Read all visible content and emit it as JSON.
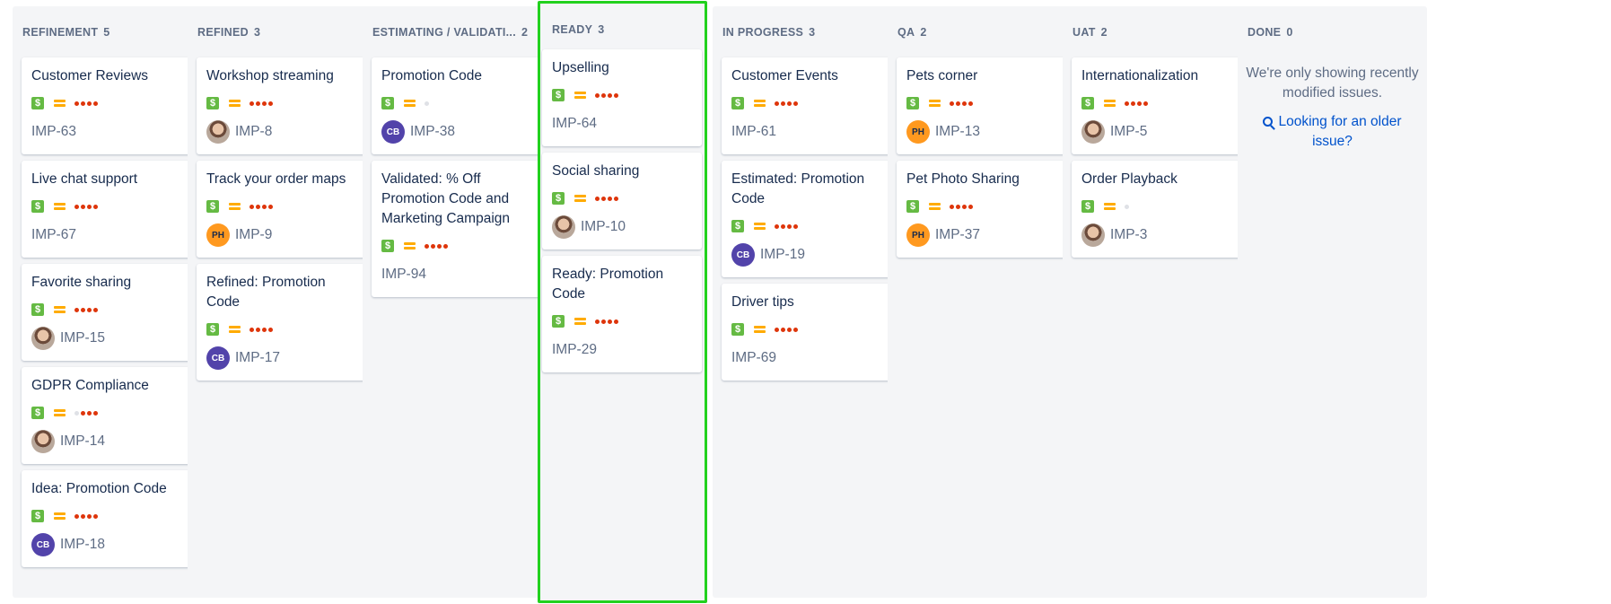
{
  "columns": [
    {
      "name": "REFINEMENT",
      "count": "5",
      "cards": [
        {
          "title": "Customer Reviews",
          "key": "IMP-63",
          "assignee": null,
          "story_points_dots": 4
        },
        {
          "title": "Live chat support",
          "key": "IMP-67",
          "assignee": null,
          "story_points_dots": 4
        },
        {
          "title": "Favorite sharing",
          "key": "IMP-15",
          "assignee": "photo",
          "story_points_dots": 4
        },
        {
          "title": "GDPR Compliance",
          "key": "IMP-14",
          "assignee": "photo",
          "story_points_dots": 3
        },
        {
          "title": "Idea: Promotion Code",
          "key": "IMP-18",
          "assignee": "CB",
          "story_points_dots": 4
        }
      ]
    },
    {
      "name": "REFINED",
      "count": "3",
      "cards": [
        {
          "title": "Workshop streaming",
          "key": "IMP-8",
          "assignee": "photo",
          "story_points_dots": 4
        },
        {
          "title": "Track your order maps",
          "key": "IMP-9",
          "assignee": "PH",
          "story_points_dots": 4
        },
        {
          "title": "Refined: Promotion Code",
          "key": "IMP-17",
          "assignee": "CB",
          "story_points_dots": 4
        }
      ]
    },
    {
      "name": "ESTIMATING / VALIDATI...",
      "count": "2",
      "cards": [
        {
          "title": "Promotion Code",
          "key": "IMP-38",
          "assignee": "CB",
          "story_points_dots": 0
        },
        {
          "title": "Validated: % Off Promotion Code and Marketing Campaign",
          "key": "IMP-94",
          "assignee": null,
          "story_points_dots": 4
        }
      ]
    },
    {
      "name": "READY",
      "count": "3",
      "highlighted": true,
      "cards": [
        {
          "title": "Upselling",
          "key": "IMP-64",
          "assignee": null,
          "story_points_dots": 4
        },
        {
          "title": "Social sharing",
          "key": "IMP-10",
          "assignee": "photo",
          "story_points_dots": 4
        },
        {
          "title": "Ready: Promotion Code",
          "key": "IMP-29",
          "assignee": null,
          "story_points_dots": 4
        }
      ]
    },
    {
      "name": "IN PROGRESS",
      "count": "3",
      "cards": [
        {
          "title": "Customer Events",
          "key": "IMP-61",
          "assignee": null,
          "story_points_dots": 4
        },
        {
          "title": "Estimated: Promotion Code",
          "key": "IMP-19",
          "assignee": "CB",
          "story_points_dots": 4
        },
        {
          "title": "Driver tips",
          "key": "IMP-69",
          "assignee": null,
          "story_points_dots": 4
        }
      ]
    },
    {
      "name": "QA",
      "count": "2",
      "cards": [
        {
          "title": "Pets corner",
          "key": "IMP-13",
          "assignee": "PH",
          "story_points_dots": 4
        },
        {
          "title": "Pet Photo Sharing",
          "key": "IMP-37",
          "assignee": "PH",
          "story_points_dots": 4
        }
      ]
    },
    {
      "name": "UAT",
      "count": "2",
      "cards": [
        {
          "title": "Internationalization",
          "key": "IMP-5",
          "assignee": "photo",
          "story_points_dots": 4
        },
        {
          "title": "Order Playback",
          "key": "IMP-3",
          "assignee": "photo",
          "story_points_dots": 0
        }
      ]
    },
    {
      "name": "DONE",
      "count": "0",
      "cards": [],
      "empty_message": "We're only showing recently modified issues.",
      "empty_link": "Looking for an older issue?"
    }
  ],
  "colors": {
    "story_type": "#65ba43",
    "priority_medium": "#ffab00",
    "dot_active": "#de350b",
    "highlight_border": "#22d11e",
    "avatar_cb": "#5243aa",
    "avatar_ph": "#ff991f"
  },
  "icons": {
    "issue_type": "story-icon",
    "priority": "medium-priority-icon",
    "search": "search-icon"
  },
  "glyphs": {
    "story_type": "$"
  }
}
